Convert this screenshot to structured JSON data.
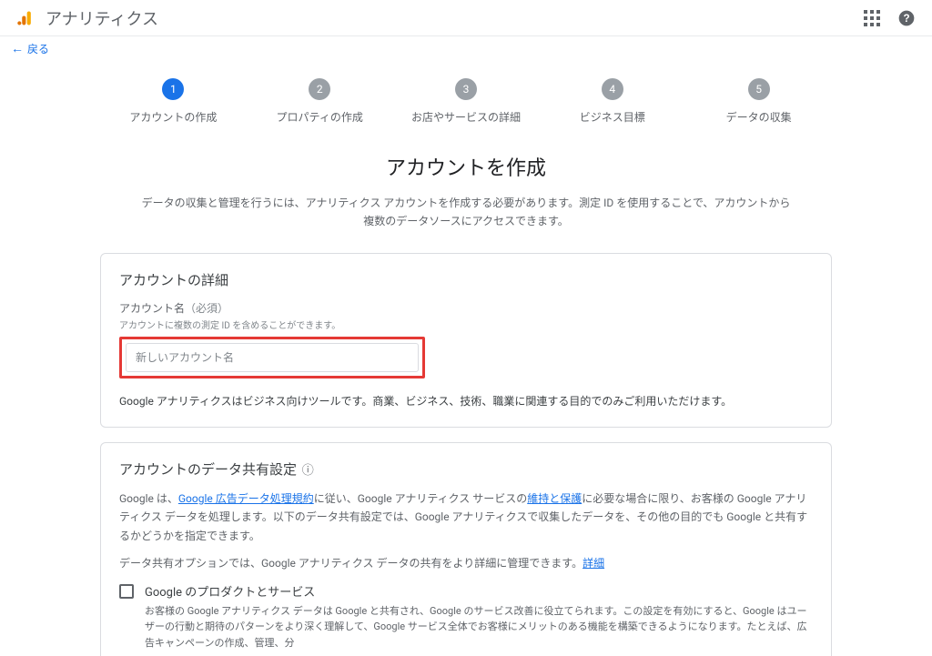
{
  "header": {
    "app_title": "アナリティクス"
  },
  "back": {
    "label": "戻る"
  },
  "stepper": {
    "steps": [
      {
        "num": "1",
        "label": "アカウントの作成"
      },
      {
        "num": "2",
        "label": "プロパティの作成"
      },
      {
        "num": "3",
        "label": "お店やサービスの詳細"
      },
      {
        "num": "4",
        "label": "ビジネス目標"
      },
      {
        "num": "5",
        "label": "データの収集"
      }
    ]
  },
  "main": {
    "title": "アカウントを作成",
    "desc": "データの収集と管理を行うには、アナリティクス アカウントを作成する必要があります。測定 ID を使用することで、アカウントから複数のデータソースにアクセスできます。"
  },
  "account_detail": {
    "title": "アカウントの詳細",
    "field_label": "アカウント名",
    "required": "（必須）",
    "field_hint": "アカウントに複数の測定 ID を含めることができます。",
    "placeholder": "新しいアカウント名",
    "note": "Google アナリティクスはビジネス向けツールです。商業、ビジネス、技術、職業に関連する目的でのみご利用いただけます。"
  },
  "data_sharing": {
    "title": "アカウントのデータ共有設定",
    "body_pre": "Google は、",
    "link1": "Google 広告データ処理規約",
    "body_mid1": "に従い、Google アナリティクス サービスの",
    "link2": "維持と保護",
    "body_mid2": "に必要な場合に限り、お客様の Google アナリティクス データを処理します。以下のデータ共有設定では、Google アナリティクスで収集したデータを、その他の目的でも Google と共有するかどうかを指定できます。",
    "body2_pre": "データ共有オプションでは、Google アナリティクス データの共有をより詳細に管理できます。",
    "link3": "詳細",
    "cb": {
      "title": "Google のプロダクトとサービス",
      "desc": "お客様の Google アナリティクス データは Google と共有され、Google のサービス改善に役立てられます。この設定を有効にすると、Google はユーザーの行動と期待のパターンをより深く理解して、Google サービス全体でお客様にメリットのある機能を構築できるようになります。たとえば、広告キャンペーンの作成、管理、分"
    }
  }
}
